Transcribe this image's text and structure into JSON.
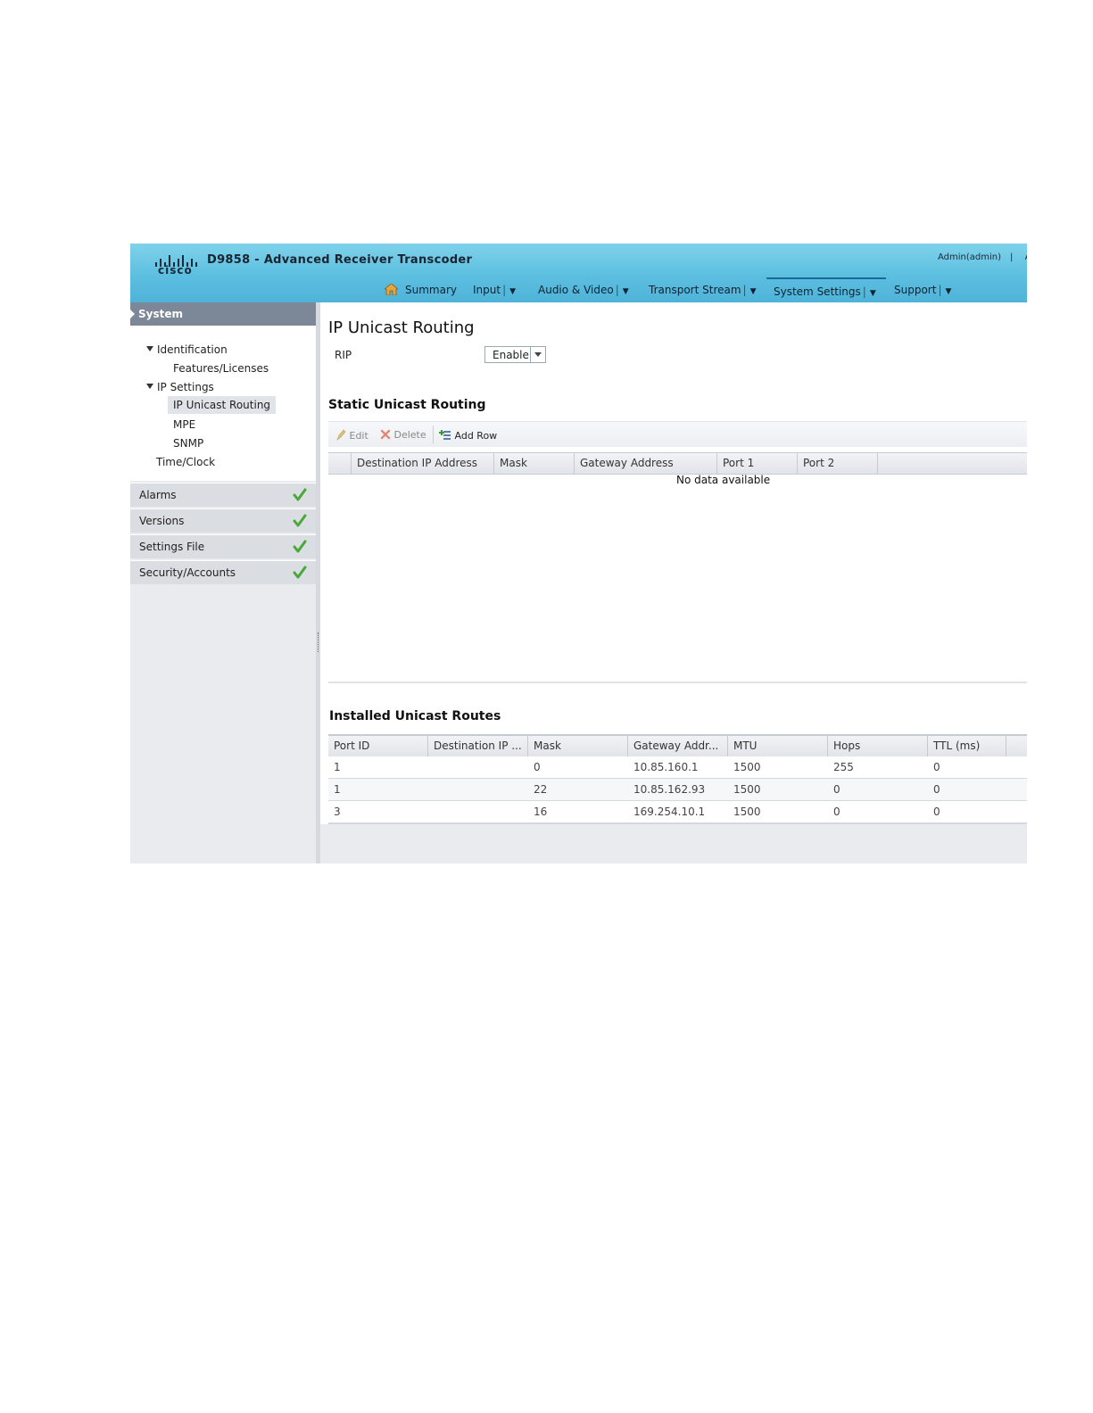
{
  "header": {
    "brand": "cisco",
    "app_title": "D9858 - Advanced Receiver Transcoder",
    "user": "Admin(admin)",
    "user_sep": "|",
    "user_extra": "A",
    "brand_color": "#5cbfe0"
  },
  "nav": {
    "summary": "Summary",
    "input": "Input",
    "audio_video": "Audio & Video",
    "transport_stream": "Transport Stream",
    "system_settings": "System Settings",
    "support": "Support",
    "active": "System Settings"
  },
  "sidebar": {
    "title": "System",
    "tree": {
      "identification": "Identification",
      "features_licenses": "Features/Licenses",
      "ip_settings": "IP Settings",
      "ip_unicast_routing": "IP Unicast Routing",
      "mpe": "MPE",
      "snmp": "SNMP",
      "time_clock": "Time/Clock"
    },
    "sections": {
      "alarms": "Alarms",
      "versions": "Versions",
      "settings_file": "Settings File",
      "security_accounts": "Security/Accounts"
    },
    "check_color": "#4aa83a"
  },
  "main": {
    "page_title": "IP Unicast Routing",
    "rip": {
      "label": "RIP",
      "value": "Enable"
    },
    "static_routing": {
      "title": "Static Unicast Routing",
      "toolbar": {
        "edit": "Edit",
        "delete": "Delete",
        "add_row": "Add Row"
      },
      "columns": {
        "dest_ip": "Destination IP Address",
        "mask": "Mask",
        "gateway": "Gateway Address",
        "port1": "Port 1",
        "port2": "Port 2"
      },
      "empty_text": "No data available"
    },
    "installed_routes": {
      "title": "Installed Unicast Routes",
      "columns": {
        "port_id": "Port ID",
        "dest_ip": "Destination IP ...",
        "mask": "Mask",
        "gateway": "Gateway Addr...",
        "mtu": "MTU",
        "hops": "Hops",
        "ttl": "TTL (ms)"
      },
      "rows": [
        {
          "port_id": "1",
          "dest_ip": "",
          "mask": "0",
          "gateway": "10.85.160.1",
          "mtu": "1500",
          "hops": "255",
          "ttl": "0"
        },
        {
          "port_id": "1",
          "dest_ip": "",
          "mask": "22",
          "gateway": "10.85.162.93",
          "mtu": "1500",
          "hops": "0",
          "ttl": "0"
        },
        {
          "port_id": "3",
          "dest_ip": "",
          "mask": "16",
          "gateway": "169.254.10.1",
          "mtu": "1500",
          "hops": "0",
          "ttl": "0"
        }
      ]
    }
  }
}
